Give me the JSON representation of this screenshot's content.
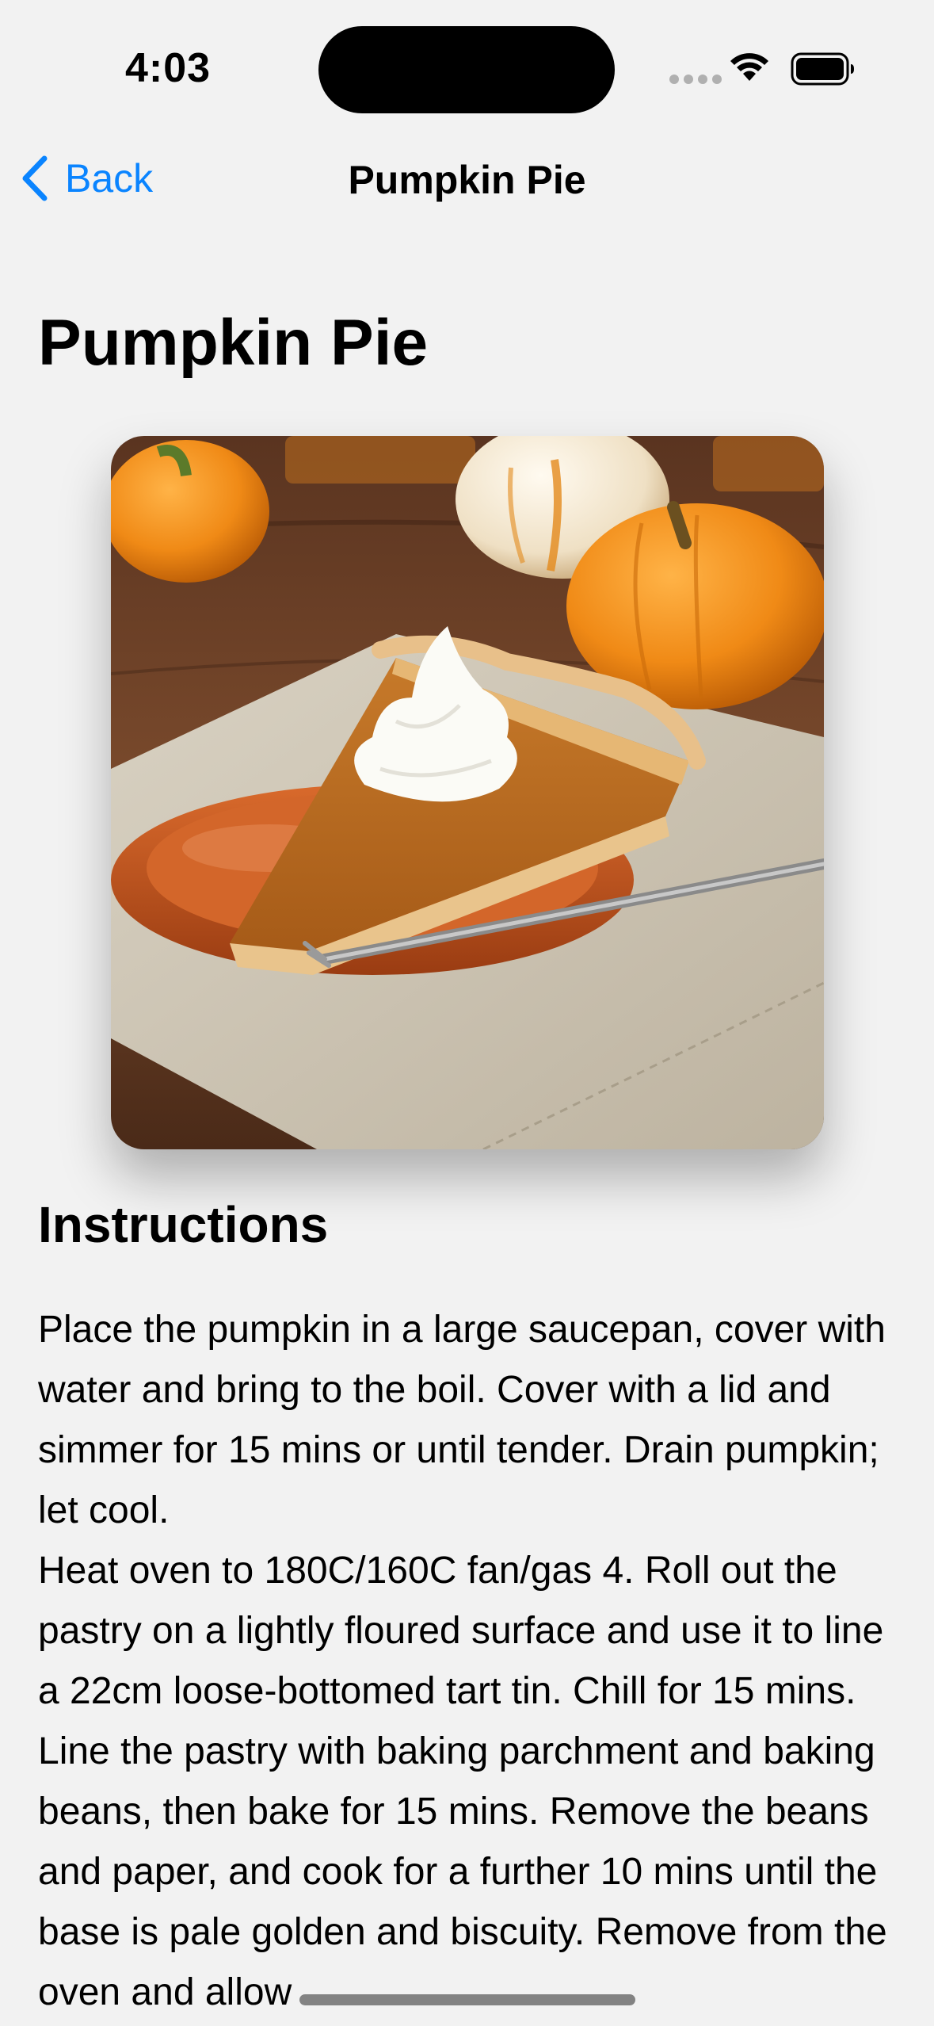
{
  "status_bar": {
    "time": "4:03",
    "icons": [
      "cellular-signal-icon",
      "wifi-icon",
      "battery-icon"
    ]
  },
  "nav": {
    "back_label": "Back",
    "title": "Pumpkin Pie",
    "back_icon": "chevron-left-icon"
  },
  "recipe": {
    "title": "Pumpkin Pie",
    "image_alt": "Slice of pumpkin pie with whipped cream on an orange plate",
    "instructions_heading": "Instructions",
    "instructions": [
      "Place the pumpkin in a large saucepan, cover with water and bring to the boil. Cover with a lid and simmer for 15 mins or until tender. Drain pumpkin; let cool.",
      "Heat oven to 180C/160C fan/gas 4. Roll out the pastry on a lightly floured surface and use it to line a 22cm loose-bottomed tart tin. Chill for 15 mins. Line the pastry with baking parchment and baking beans, then bake for 15 mins. Remove the beans and paper, and cook for a further 10 mins until the base is pale golden and biscuity. Remove from the oven and allow"
    ]
  },
  "colors": {
    "accent": "#0a84ff",
    "background": "#f2f2f2"
  }
}
